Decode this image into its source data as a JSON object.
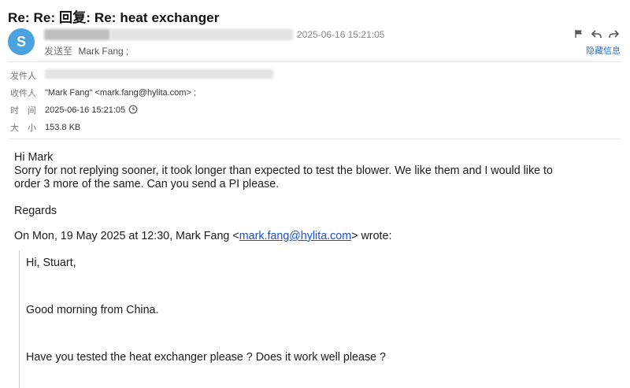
{
  "email": {
    "subject": "Re: Re: 回复: Re: heat exchanger",
    "avatar_letter": "S",
    "header_date": "2025-06-16 15:21:05",
    "sendto_label": "发送至",
    "sendto_value": "Mark Fang ;",
    "hide_info": "隐藏信息",
    "icons": [
      "flag-icon",
      "reply-icon",
      "forward-icon"
    ],
    "meta": {
      "from_label": "发件人",
      "to_label": "收件人",
      "to_value": "\"Mark Fang\" <mark.fang@hylita.com> ;",
      "time_label": "时　间",
      "time_value": "2025-06-16 15:21:05",
      "size_label": "大　小",
      "size_value": "153.8 KB"
    },
    "body": {
      "greeting": "Hi Mark",
      "line1": "Sorry for not replying sooner, it took longer than expected to test the blower. We like them and I would like to",
      "line2": "order 3 more of the same. Can you send a PI please.",
      "regards": "Regards"
    },
    "quote_header": {
      "prefix": "On Mon, 19 May 2025 at 12:30, Mark Fang <",
      "email": "mark.fang@hylita.com",
      "suffix": "> wrote:"
    },
    "quote": {
      "line1": "Hi, Stuart,",
      "line2": "Good morning from China.",
      "line3": "Have you tested the heat exchanger please ?  Does it work well please ?"
    }
  }
}
